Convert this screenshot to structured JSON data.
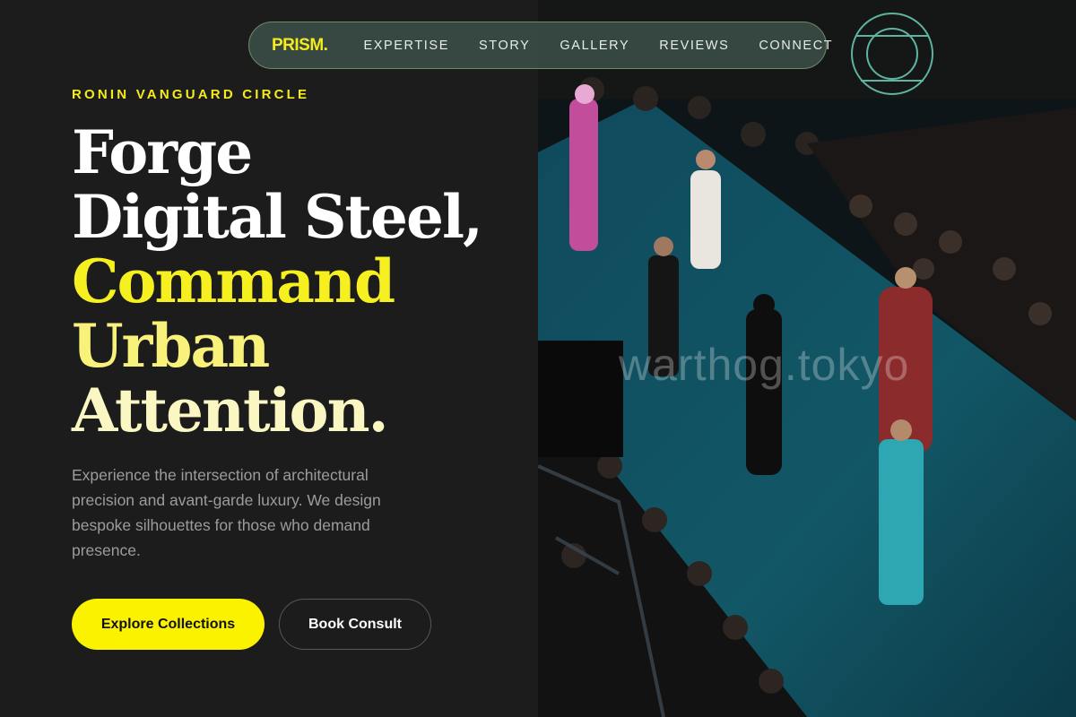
{
  "nav": {
    "logo": "PRISM.",
    "links": [
      "EXPERTISE",
      "STORY",
      "GALLERY",
      "REVIEWS",
      "CONNECT"
    ]
  },
  "hero": {
    "eyebrow": "RONIN VANGUARD CIRCLE",
    "headline_lines": [
      "Forge",
      "Digital Steel,",
      "Command",
      "Urban",
      "Attention."
    ],
    "description": "Experience the intersection of architectural precision and avant-garde luxury. We design bespoke silhouettes for those who demand presence.",
    "primary_cta": "Explore Collections",
    "secondary_cta": "Book Consult"
  },
  "image": {
    "watermark": "warthog.tokyo"
  },
  "colors": {
    "accent": "#FBF200",
    "background": "#1C1C1C",
    "nav_background": "#3A4C46",
    "nav_border": "#6E8A62"
  }
}
